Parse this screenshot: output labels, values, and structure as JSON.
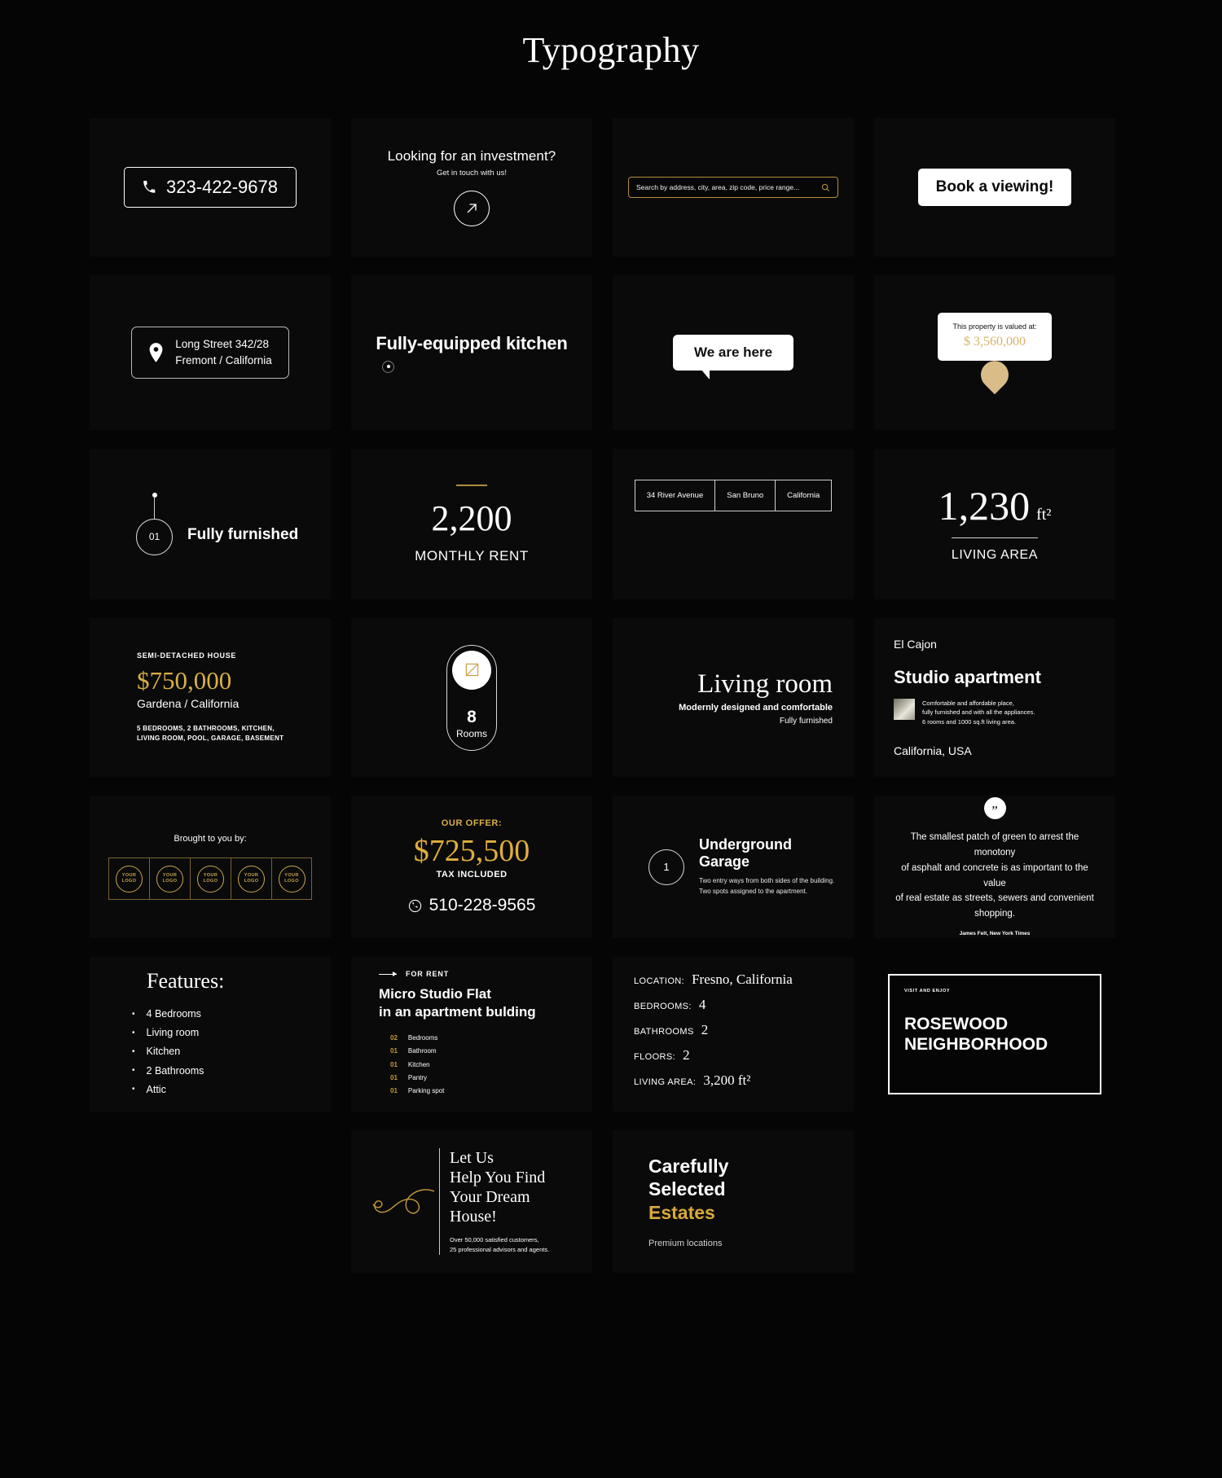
{
  "page": {
    "title": "Typography"
  },
  "cards": {
    "phone": {
      "name": "phone-number-pill",
      "icon": "phone-icon",
      "number": "323-422-9678"
    },
    "investment": {
      "title": "Looking for an investment?",
      "subtitle": "Get in touch with us!",
      "icon": "arrow-up-right-icon"
    },
    "search": {
      "placeholder": "Search by address, city, area, zip code, price range...",
      "value": "",
      "icon": "search-icon",
      "border_color": "#b68d3e"
    },
    "booking": {
      "label": "Book a viewing!"
    },
    "address_pill": {
      "icon": "map-pin-icon",
      "line1": "Long Street 342/28",
      "line2": "Fremont / California"
    },
    "kitchen": {
      "title": "Fully-equipped kitchen",
      "icon": "dot-ring-icon"
    },
    "we_are_here": {
      "label": "We are here"
    },
    "valuation": {
      "label": "This property is valued at:",
      "amount": "$ 3,560,000",
      "amount_color": "#d9b26a",
      "icon": "map-pin-filled-icon"
    },
    "numbered_feature": {
      "number": "01",
      "label": "Fully furnished"
    },
    "monthly_rent": {
      "value": "2,200",
      "label": "MONTHLY RENT",
      "rule_color": "#b08c40"
    },
    "address_table": {
      "cells": [
        "34 River Avenue",
        "San Bruno",
        "California"
      ]
    },
    "living_area": {
      "value": "1,230",
      "unit": "ft²",
      "label": "LIVING AREA"
    },
    "listing": {
      "kicker": "SEMI-DETACHED HOUSE",
      "price": "$750,000",
      "price_color": "#d9b045",
      "location": "Gardena / California",
      "spec_line1": "5 BEDROOMS, 2 BATHROOMS, KITCHEN,",
      "spec_line2": "LIVING ROOM, POOL, GARAGE, BASEMENT"
    },
    "rooms": {
      "icon": "image-frame-icon",
      "count": "8",
      "label": "Rooms"
    },
    "living_room": {
      "title": "Living room",
      "sub1": "Modernly designed and comfortable",
      "sub2": "Fully furnished"
    },
    "studio": {
      "city": "El Cajon",
      "title": "Studio apartment",
      "thumb": "property-thumbnail",
      "desc_line1": "Comfortable and affordable place,",
      "desc_line2": "fully furnished and with all the appliances.",
      "desc_line3": "6 rooms and 1000 sq.ft living area.",
      "country": "California, USA"
    },
    "logos": {
      "lead": "Brought to you by:",
      "items": [
        {
          "line1": "YOUR",
          "line2": "LOGO"
        },
        {
          "line1": "YOUR",
          "line2": "LOGO"
        },
        {
          "line1": "YOUR",
          "line2": "LOGO"
        },
        {
          "line1": "YOUR",
          "line2": "LOGO"
        },
        {
          "line1": "YOUR",
          "line2": "LOGO"
        }
      ],
      "accent": "#c9a44f"
    },
    "offer": {
      "label": "OUR OFFER:",
      "price": "$725,500",
      "price_color": "#e0ae3c",
      "tax": "TAX INCLUDED",
      "phone_icon": "phone-circle-icon",
      "phone": "510-228-9565"
    },
    "garage": {
      "number": "1",
      "title": "Underground Garage",
      "sub1": "Two entry ways from both sides of the building.",
      "sub2": "Two spots assigned to the apartment."
    },
    "quote": {
      "icon": "quote-mark-icon",
      "line1": "The smallest patch of green to arrest the monotony",
      "line2": "of asphalt and concrete is as important to the value",
      "line3": "of real estate as streets, sewers and convenient shopping.",
      "author": "James Felt, New York Times"
    },
    "features": {
      "title": "Features:",
      "items": [
        "4 Bedrooms",
        "Living room",
        "Kitchen",
        "2 Bathrooms",
        "Attic"
      ]
    },
    "micro_studio": {
      "kicker": "FOR RENT",
      "title_line1": "Micro Studio Flat",
      "title_line2": "in an apartment bulding",
      "rows": [
        {
          "num": "02",
          "label": "Bedrooms"
        },
        {
          "num": "01",
          "label": "Bathroom"
        },
        {
          "num": "01",
          "label": "Kitchen"
        },
        {
          "num": "01",
          "label": "Pantry"
        },
        {
          "num": "01",
          "label": "Parking spot"
        }
      ],
      "num_color": "#c79a3c"
    },
    "specs": {
      "rows": [
        {
          "key": "LOCATION:",
          "value": "Fresno, California"
        },
        {
          "key": "BEDROOMS:",
          "value": "4"
        },
        {
          "key": "BATHROOMS",
          "value": "2"
        },
        {
          "key": "FLOORS:",
          "value": "2"
        },
        {
          "key": "LIVING AREA:",
          "value": "3,200 ft²"
        }
      ]
    },
    "rosewood": {
      "kicker": "VISIT AND ENJOY",
      "title_line1": "ROSEWOOD",
      "title_line2": "NEIGHBORHOOD"
    },
    "dream": {
      "icon": "swirl-flourish-icon",
      "line1": "Let Us",
      "line2": "Help You Find",
      "line3": "Your Dream House!",
      "sub1": "Over 50,000 satisfied customers,",
      "sub2": "25 professional advisors and agents."
    },
    "carefully": {
      "line1": "Carefully",
      "line2": "Selected",
      "line3": "Estates",
      "line3_color": "#d9a93c",
      "sub": "Premium locations"
    }
  }
}
